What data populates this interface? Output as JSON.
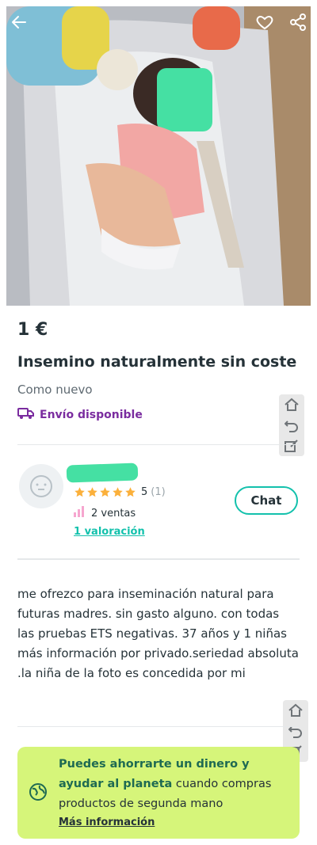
{
  "product": {
    "price": "1 €",
    "title": "Insemino naturalmente sin coste",
    "condition": "Como nuevo",
    "shipping": "Envío disponible"
  },
  "seller": {
    "rating_value": "5",
    "rating_count": "(1)",
    "stars": 5,
    "sales": "2 ventas",
    "reviews_link": "1 valoración",
    "chat_label": "Chat"
  },
  "description": "me ofrezco para inseminación natural para futuras madres. sin gasto alguno.  con todas las pruebas ETS negativas. 37 años y 1 niñas más información por privado.seriedad absoluta .la niña de la foto es concedida por mi",
  "eco_banner": {
    "bold_text": "Puedes ahorrarte un dinero y ayudar al planeta",
    "rest_text": " cuando compras productos de segunda mano",
    "link": "Más información"
  },
  "colors": {
    "accent": "#13c1ac",
    "shipping": "#7a2c9f",
    "eco_bg": "#d6f57a",
    "mask_green": "#45e0a3"
  },
  "icons": [
    "back-arrow-icon",
    "heart-icon",
    "share-icon",
    "truck-icon",
    "star-icon",
    "bar-chart-icon",
    "globe-icon",
    "home-icon",
    "undo-icon",
    "edit-icon"
  ]
}
